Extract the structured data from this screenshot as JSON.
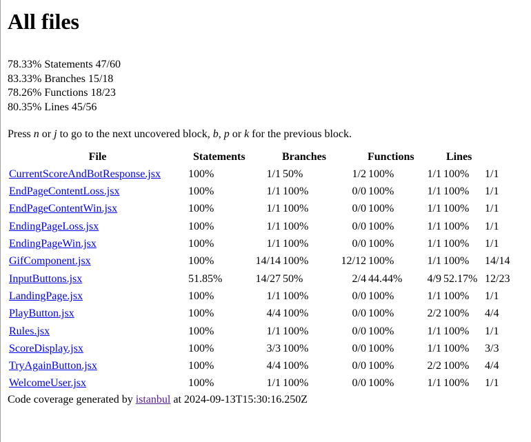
{
  "page_title": "All files",
  "summary": [
    {
      "pct": "78.33%",
      "label": "Statements",
      "ratio": "47/60"
    },
    {
      "pct": "83.33%",
      "label": "Branches",
      "ratio": "15/18"
    },
    {
      "pct": "78.26%",
      "label": "Functions",
      "ratio": "18/23"
    },
    {
      "pct": "80.35%",
      "label": "Lines",
      "ratio": "45/56"
    }
  ],
  "hint": {
    "t1": "Press ",
    "k1": "n",
    "t2": " or ",
    "k2": "j",
    "t3": " to go to the next uncovered block, ",
    "k3": "b",
    "t4": ", ",
    "k4": "p",
    "t5": " or ",
    "k5": "k",
    "t6": " for the previous block."
  },
  "table": {
    "headers": [
      "File",
      "Statements",
      "Branches",
      "Functions",
      "Lines"
    ],
    "rows": [
      {
        "file": "CurrentScoreAndBotResponse.jsx",
        "s_pct": "100%",
        "s": "1/1",
        "b_pct": "50%",
        "b": "1/2",
        "f_pct": "100%",
        "f": "1/1",
        "l_pct": "100%",
        "l": "1/1"
      },
      {
        "file": "EndPageContentLoss.jsx",
        "s_pct": "100%",
        "s": "1/1",
        "b_pct": "100%",
        "b": "0/0",
        "f_pct": "100%",
        "f": "1/1",
        "l_pct": "100%",
        "l": "1/1"
      },
      {
        "file": "EndPageContentWin.jsx",
        "s_pct": "100%",
        "s": "1/1",
        "b_pct": "100%",
        "b": "0/0",
        "f_pct": "100%",
        "f": "1/1",
        "l_pct": "100%",
        "l": "1/1"
      },
      {
        "file": "EndingPageLoss.jsx",
        "s_pct": "100%",
        "s": "1/1",
        "b_pct": "100%",
        "b": "0/0",
        "f_pct": "100%",
        "f": "1/1",
        "l_pct": "100%",
        "l": "1/1"
      },
      {
        "file": "EndingPageWin.jsx",
        "s_pct": "100%",
        "s": "1/1",
        "b_pct": "100%",
        "b": "0/0",
        "f_pct": "100%",
        "f": "1/1",
        "l_pct": "100%",
        "l": "1/1"
      },
      {
        "file": "GifComponent.jsx",
        "s_pct": "100%",
        "s": "14/14",
        "b_pct": "100%",
        "b": "12/12",
        "f_pct": "100%",
        "f": "1/1",
        "l_pct": "100%",
        "l": "14/14"
      },
      {
        "file": "InputButtons.jsx",
        "s_pct": "51.85%",
        "s": "14/27",
        "b_pct": "50%",
        "b": "2/4",
        "f_pct": "44.44%",
        "f": "4/9",
        "l_pct": "52.17%",
        "l": "12/23"
      },
      {
        "file": "LandingPage.jsx",
        "s_pct": "100%",
        "s": "1/1",
        "b_pct": "100%",
        "b": "0/0",
        "f_pct": "100%",
        "f": "1/1",
        "l_pct": "100%",
        "l": "1/1"
      },
      {
        "file": "PlayButton.jsx",
        "s_pct": "100%",
        "s": "4/4",
        "b_pct": "100%",
        "b": "0/0",
        "f_pct": "100%",
        "f": "2/2",
        "l_pct": "100%",
        "l": "4/4"
      },
      {
        "file": "Rules.jsx",
        "s_pct": "100%",
        "s": "1/1",
        "b_pct": "100%",
        "b": "0/0",
        "f_pct": "100%",
        "f": "1/1",
        "l_pct": "100%",
        "l": "1/1"
      },
      {
        "file": "ScoreDisplay.jsx",
        "s_pct": "100%",
        "s": "3/3",
        "b_pct": "100%",
        "b": "0/0",
        "f_pct": "100%",
        "f": "1/1",
        "l_pct": "100%",
        "l": "3/3"
      },
      {
        "file": "TryAgainButton.jsx",
        "s_pct": "100%",
        "s": "4/4",
        "b_pct": "100%",
        "b": "0/0",
        "f_pct": "100%",
        "f": "2/2",
        "l_pct": "100%",
        "l": "4/4"
      },
      {
        "file": "WelcomeUser.jsx",
        "s_pct": "100%",
        "s": "1/1",
        "b_pct": "100%",
        "b": "0/0",
        "f_pct": "100%",
        "f": "1/1",
        "l_pct": "100%",
        "l": "1/1"
      }
    ]
  },
  "footer": {
    "prefix": "Code coverage generated by ",
    "link": "istanbul",
    "suffix": " at 2024-09-13T15:30:16.250Z"
  },
  "colors": {
    "link": "#0000ee",
    "visited_link": "#551a8b",
    "text": "#000000",
    "background": "#ffffff"
  }
}
